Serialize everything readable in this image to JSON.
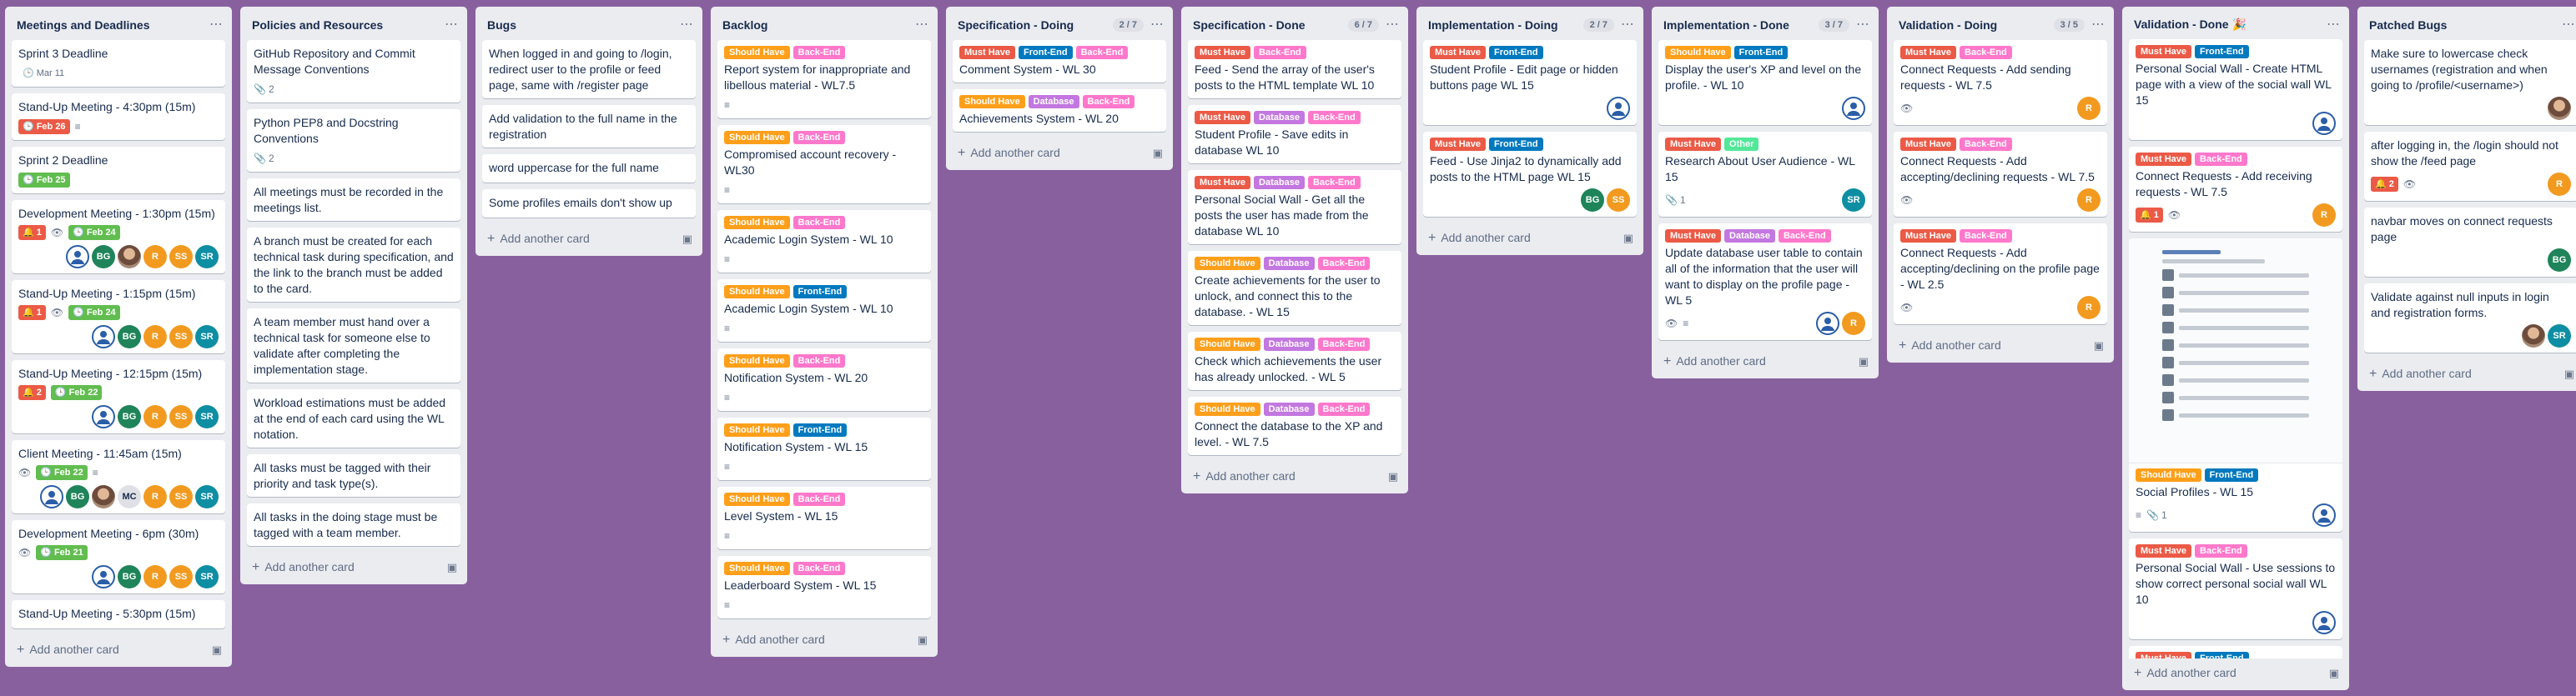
{
  "colors": {
    "board_bg": "#89609e",
    "must": "#eb5a46",
    "should": "#ff9f1a",
    "backend": "#ff78cb",
    "frontend": "#0079bf",
    "database": "#c377e0",
    "other": "#51e898",
    "due_red": "#eb5a46",
    "due_green": "#61bd4f"
  },
  "add_card_label": "Add another card",
  "lists": [
    {
      "title": "Meetings and Deadlines",
      "cards": [
        {
          "title": "Sprint 3 Deadline",
          "due": {
            "text": "Mar 11",
            "style": "plain"
          }
        },
        {
          "title": "Stand-Up Meeting - 4:30pm (15m)",
          "due": {
            "text": "Feb 26",
            "style": "red"
          },
          "desc": true
        },
        {
          "title": "Sprint 2 Deadline",
          "due": {
            "text": "Feb 25",
            "style": "green"
          }
        },
        {
          "title": "Development Meeting - 1:30pm (15m)",
          "alert": "1",
          "watch": true,
          "due": {
            "text": "Feb 24",
            "style": "green"
          },
          "members": [
            "me",
            "BG",
            "ph",
            "R",
            "SS",
            "SR"
          ]
        },
        {
          "title": "Stand-Up Meeting - 1:15pm (15m)",
          "alert": "1",
          "watch": true,
          "due": {
            "text": "Feb 24",
            "style": "green"
          },
          "members": [
            "me",
            "BG",
            "R",
            "SS",
            "SR"
          ]
        },
        {
          "title": "Stand-Up Meeting - 12:15pm (15m)",
          "alert": "2",
          "due": {
            "text": "Feb 22",
            "style": "green"
          },
          "members": [
            "me",
            "BG",
            "R",
            "SS",
            "SR"
          ]
        },
        {
          "title": "Client Meeting - 11:45am (15m)",
          "watch": true,
          "due": {
            "text": "Feb 22",
            "style": "green"
          },
          "desc": true,
          "members": [
            "me",
            "BG",
            "ph",
            "MC",
            "R",
            "SS",
            "SR"
          ]
        },
        {
          "title": "Development Meeting - 6pm (30m)",
          "watch": true,
          "due": {
            "text": "Feb 21",
            "style": "green"
          },
          "members": [
            "me",
            "BG",
            "R",
            "SS",
            "SR"
          ]
        },
        {
          "title": "Stand-Up Meeting - 5:30pm (15m)"
        }
      ]
    },
    {
      "title": "Policies and Resources",
      "cards": [
        {
          "title": "GitHub Repository and Commit Message Conventions",
          "attach": "2"
        },
        {
          "title": "Python PEP8 and Docstring Conventions",
          "attach": "2"
        },
        {
          "title": "All meetings must be recorded in the meetings list."
        },
        {
          "title": "A branch must be created for each technical task during specification, and the link to the branch must be added to the card."
        },
        {
          "title": "A team member must hand over a technical task for someone else to validate after completing the implementation stage."
        },
        {
          "title": "Workload estimations must be added at the end of each card using the WL notation."
        },
        {
          "title": "All tasks must be tagged with their priority and task type(s)."
        },
        {
          "title": "All tasks in the doing stage must be tagged with a team member."
        }
      ]
    },
    {
      "title": "Bugs",
      "cards": [
        {
          "title": "When logged in and going to /login, redirect user to the profile or feed page, same with /register page"
        },
        {
          "title": "Add validation to the full name in the registration"
        },
        {
          "title": "word uppercase for the full name"
        },
        {
          "title": "Some profiles emails don't show up"
        }
      ]
    },
    {
      "title": "Backlog",
      "cards": [
        {
          "labels": [
            "Should Have",
            "Back-End"
          ],
          "title": "Report system for inappropriate and libellous material - WL7.5",
          "desc": true
        },
        {
          "labels": [
            "Should Have",
            "Back-End"
          ],
          "title": "Compromised account recovery - WL30",
          "desc": true
        },
        {
          "labels": [
            "Should Have",
            "Back-End"
          ],
          "title": "Academic Login System - WL 10",
          "desc": true
        },
        {
          "labels": [
            "Should Have",
            "Front-End"
          ],
          "title": "Academic Login System - WL 10",
          "desc": true
        },
        {
          "labels": [
            "Should Have",
            "Back-End"
          ],
          "title": "Notification System - WL 20",
          "desc": true
        },
        {
          "labels": [
            "Should Have",
            "Front-End"
          ],
          "title": "Notification System - WL 15",
          "desc": true
        },
        {
          "labels": [
            "Should Have",
            "Back-End"
          ],
          "title": "Level System - WL 15",
          "desc": true
        },
        {
          "labels": [
            "Should Have",
            "Back-End"
          ],
          "title": "Leaderboard System - WL 15",
          "desc": true
        }
      ]
    },
    {
      "title": "Specification - Doing",
      "wip": "2 / 7",
      "cards": [
        {
          "labels": [
            "Must Have",
            "Front-End",
            "Back-End"
          ],
          "title": "Comment System - WL 30"
        },
        {
          "labels": [
            "Should Have",
            "Database",
            "Back-End"
          ],
          "title": "Achievements System - WL 20"
        }
      ]
    },
    {
      "title": "Specification - Done",
      "wip": "6 / 7",
      "cards": [
        {
          "labels": [
            "Must Have",
            "Back-End"
          ],
          "title": "Feed - Send the array of the user's posts to the HTML template WL 10"
        },
        {
          "labels": [
            "Must Have",
            "Database",
            "Back-End"
          ],
          "title": "Student Profile - Save edits in database WL 10"
        },
        {
          "labels": [
            "Must Have",
            "Database",
            "Back-End"
          ],
          "title": "Personal Social Wall - Get all the posts the user has made from the database WL 10"
        },
        {
          "labels": [
            "Should Have",
            "Database",
            "Back-End"
          ],
          "title": "Create achievements for the user to unlock, and connect this to the database. - WL 15"
        },
        {
          "labels": [
            "Should Have",
            "Database",
            "Back-End"
          ],
          "title": "Check which achievements the user has already unlocked. - WL 5"
        },
        {
          "labels": [
            "Should Have",
            "Database",
            "Back-End"
          ],
          "title": "Connect the database to the XP and level. - WL 7.5"
        }
      ]
    },
    {
      "title": "Implementation - Doing",
      "wip": "2 / 7",
      "cards": [
        {
          "labels": [
            "Must Have",
            "Front-End"
          ],
          "title": "Student Profile - Edit page or hidden buttons page WL 15",
          "members": [
            "me"
          ]
        },
        {
          "labels": [
            "Must Have",
            "Front-End"
          ],
          "title": "Feed - Use Jinja2 to dynamically add posts to the HTML page WL 15",
          "members": [
            "BG",
            "SS"
          ]
        }
      ]
    },
    {
      "title": "Implementation - Done",
      "wip": "3 / 7",
      "cards": [
        {
          "labels": [
            "Should Have",
            "Front-End"
          ],
          "title": "Display the user's XP and level on the profile. - WL 10",
          "members": [
            "me"
          ]
        },
        {
          "labels": [
            "Must Have",
            "Other"
          ],
          "title": "Research About User Audience - WL 15",
          "attach": "1",
          "members": [
            "SR"
          ]
        },
        {
          "labels": [
            "Must Have",
            "Database",
            "Back-End"
          ],
          "title": "Update database user table to contain all of the information that the user will want to display on the profile page - WL 5",
          "watch": true,
          "desc": true,
          "members": [
            "me",
            "R"
          ]
        }
      ]
    },
    {
      "title": "Validation - Doing",
      "wip": "3 / 5",
      "cards": [
        {
          "labels": [
            "Must Have",
            "Back-End"
          ],
          "title": "Connect Requests - Add sending requests - WL 7.5",
          "watch": true,
          "members": [
            "R"
          ]
        },
        {
          "labels": [
            "Must Have",
            "Back-End"
          ],
          "title": "Connect Requests - Add accepting/declining requests - WL 7.5",
          "watch": true,
          "members": [
            "R"
          ]
        },
        {
          "labels": [
            "Must Have",
            "Back-End"
          ],
          "title": "Connect Requests - Add accepting/declining on the profile page - WL 2.5",
          "watch": true,
          "members": [
            "R"
          ]
        }
      ]
    },
    {
      "title": "Validation - Done 🎉",
      "cards": [
        {
          "labels": [
            "Must Have",
            "Front-End"
          ],
          "title": "Personal Social Wall - Create HTML page with a view of the social wall WL 15",
          "members": [
            "me"
          ]
        },
        {
          "labels": [
            "Must Have",
            "Back-End"
          ],
          "title": "Connect Requests - Add receiving requests - WL 7.5",
          "alert": "1",
          "watch": true,
          "members": [
            "R"
          ]
        },
        {
          "labels": [
            "Should Have",
            "Front-End"
          ],
          "title": "Social Profiles - WL 15",
          "thumb": true,
          "desc": true,
          "attach": "1",
          "members": [
            "me"
          ]
        },
        {
          "labels": [
            "Must Have",
            "Back-End"
          ],
          "title": "Personal Social Wall - Use sessions to show correct personal social wall WL 10",
          "members": [
            "me"
          ]
        },
        {
          "labels": [
            "Must Have",
            "Front-End"
          ],
          "title": ""
        }
      ]
    },
    {
      "title": "Patched Bugs",
      "cards": [
        {
          "title": "Make sure to lowercase check usernames (registration and when going to /profile/<username>)",
          "members": [
            "ph"
          ]
        },
        {
          "title": "after logging in, the /login should not show the /feed page",
          "alert": "2",
          "watch": true,
          "members": [
            "R"
          ]
        },
        {
          "title": "navbar moves on connect requests page",
          "members": [
            "BG"
          ]
        },
        {
          "title": "Validate against null inputs in login and registration forms.",
          "members": [
            "ph",
            "SR"
          ]
        }
      ]
    }
  ]
}
